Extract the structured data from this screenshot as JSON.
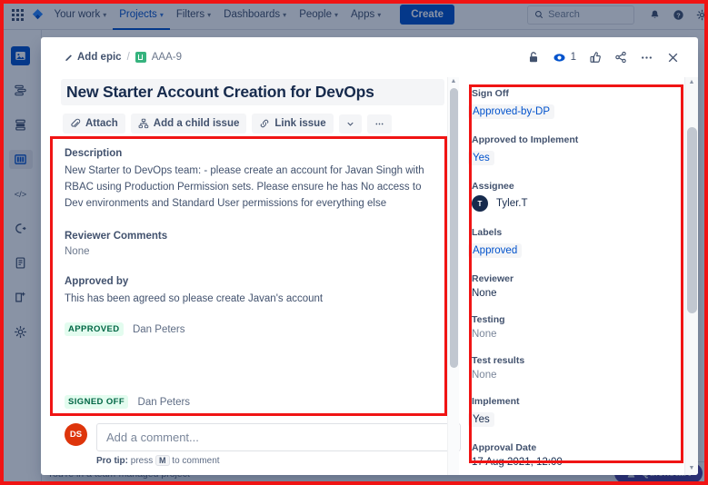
{
  "topnav": {
    "items": [
      {
        "label": "Your work",
        "caret": true,
        "active": false
      },
      {
        "label": "Projects",
        "caret": true,
        "active": true
      },
      {
        "label": "Filters",
        "caret": true,
        "active": false
      },
      {
        "label": "Dashboards",
        "caret": true,
        "active": false
      },
      {
        "label": "People",
        "caret": true,
        "active": false
      },
      {
        "label": "Apps",
        "caret": true,
        "active": false
      }
    ],
    "create_label": "Create",
    "search_placeholder": "Search",
    "icons": [
      "apps-grid-icon",
      "jira-logo-icon",
      "notifications-bell-icon",
      "help-question-icon",
      "settings-gear-icon"
    ]
  },
  "left_rail": {
    "items": [
      "project-avatar-icon",
      "backlog-icon",
      "board-stack-icon",
      "board-columns-icon",
      "code-icon",
      "releases-icon",
      "pages-icon",
      "add-item-icon",
      "project-settings-icon"
    ],
    "selected_index": 3
  },
  "app_footer": {
    "text": "You're in a team-managed project",
    "help_badge": "Quickstart"
  },
  "modal": {
    "breadcrumb": {
      "add_epic": "Add epic",
      "separator": "/",
      "issue_key": "AAA-9"
    },
    "header_actions": [
      {
        "name": "unlock-icon",
        "label": ""
      },
      {
        "name": "watch-eye-icon",
        "label": "1"
      },
      {
        "name": "thumbs-up-icon",
        "label": ""
      },
      {
        "name": "share-icon",
        "label": ""
      },
      {
        "name": "more-actions-icon",
        "label": ""
      },
      {
        "name": "close-icon",
        "label": ""
      }
    ],
    "watch_count": "1",
    "title": "New Starter Account Creation for DevOps",
    "action_buttons": [
      {
        "label": "Attach",
        "icon": "paperclip-icon"
      },
      {
        "label": "Add a child issue",
        "icon": "child-issue-icon"
      },
      {
        "label": "Link issue",
        "icon": "link-icon"
      },
      {
        "label": "",
        "icon": "chevron-down-icon"
      },
      {
        "label": "",
        "icon": "more-options-icon"
      }
    ],
    "fields": {
      "description_label": "Description",
      "description_text": "New Starter to DevOps team: - please create an account for Javan Singh with RBAC using Production Permission sets. Please ensure he has No access to Dev environments and Standard User permissions for everything else",
      "reviewer_comments_label": "Reviewer Comments",
      "reviewer_comments_value": "None",
      "approved_by_label": "Approved by",
      "approved_by_text": "This has been agreed so please create Javan's account",
      "approved_badge": "APPROVED",
      "approved_name": "Dan Peters",
      "signed_off_badge": "SIGNED OFF",
      "signed_off_name": "Dan Peters"
    },
    "comment": {
      "avatar_initials": "DS",
      "placeholder": "Add a comment...",
      "protip_prefix": "Pro tip:",
      "protip_mid": "press",
      "protip_key": "M",
      "protip_suffix": "to comment"
    },
    "sidebar": [
      {
        "label": "Sign Off",
        "value": "Approved-by-DP",
        "style": "chip"
      },
      {
        "label": "Approved to Implement",
        "value": "Yes",
        "style": "chip"
      },
      {
        "label": "Assignee",
        "value": "Tyler.T",
        "style": "avatar",
        "avatar_initials": "T"
      },
      {
        "label": "Labels",
        "value": "Approved",
        "style": "chip"
      },
      {
        "label": "Reviewer",
        "value": "None",
        "style": "text"
      },
      {
        "label": "Testing",
        "value": "None",
        "style": "text-gray"
      },
      {
        "label": "Test results",
        "value": "None",
        "style": "text-gray"
      },
      {
        "label": "Implement",
        "value": "Yes",
        "style": "chip-plain"
      },
      {
        "label": "Approval Date",
        "value": "17 Aug 2021, 12:00",
        "style": "text"
      }
    ]
  },
  "annotations": {
    "outer_frame_color": "#f01414",
    "left_box_label": "description-fields-highlight",
    "right_box_label": "custom-fields-highlight"
  }
}
